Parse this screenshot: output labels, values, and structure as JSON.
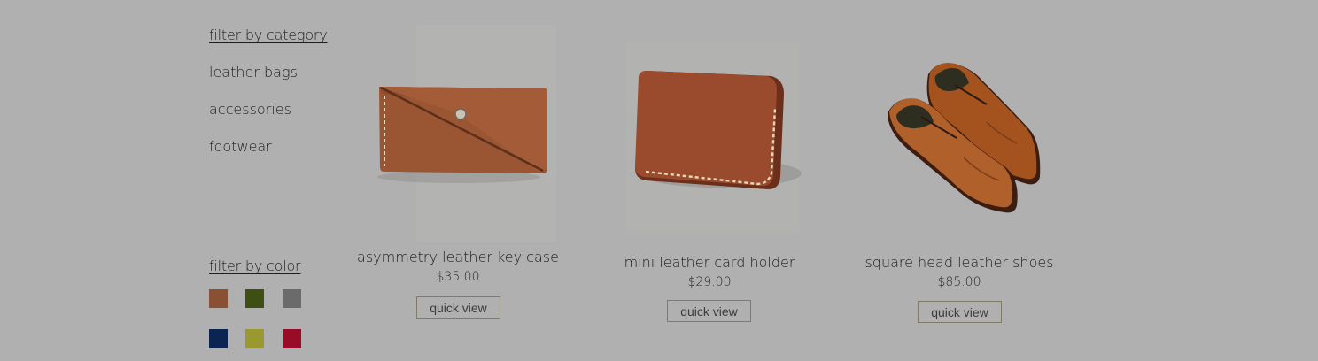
{
  "sidebar": {
    "category_heading": "filter by category",
    "categories": [
      {
        "label": "leather bags"
      },
      {
        "label": "accessories"
      },
      {
        "label": "footwear"
      }
    ],
    "color_heading": "filter by color",
    "colors": [
      {
        "name": "brown",
        "hex": "#8a5033"
      },
      {
        "name": "olive green",
        "hex": "#3f4f13"
      },
      {
        "name": "gray",
        "hex": "#6b6b6b"
      },
      {
        "name": "navy",
        "hex": "#0c2451"
      },
      {
        "name": "mustard",
        "hex": "#9a9830"
      },
      {
        "name": "crimson",
        "hex": "#980c27"
      }
    ]
  },
  "products": [
    {
      "name": "asymmetry leather key case",
      "price": "$35.00",
      "action": "quick view",
      "image": "leather-key-case"
    },
    {
      "name": "mini leather card holder",
      "price": "$29.00",
      "action": "quick view",
      "image": "leather-card-holder"
    },
    {
      "name": "square head leather shoes",
      "price": "$85.00",
      "action": "quick view",
      "image": "leather-shoes"
    }
  ]
}
